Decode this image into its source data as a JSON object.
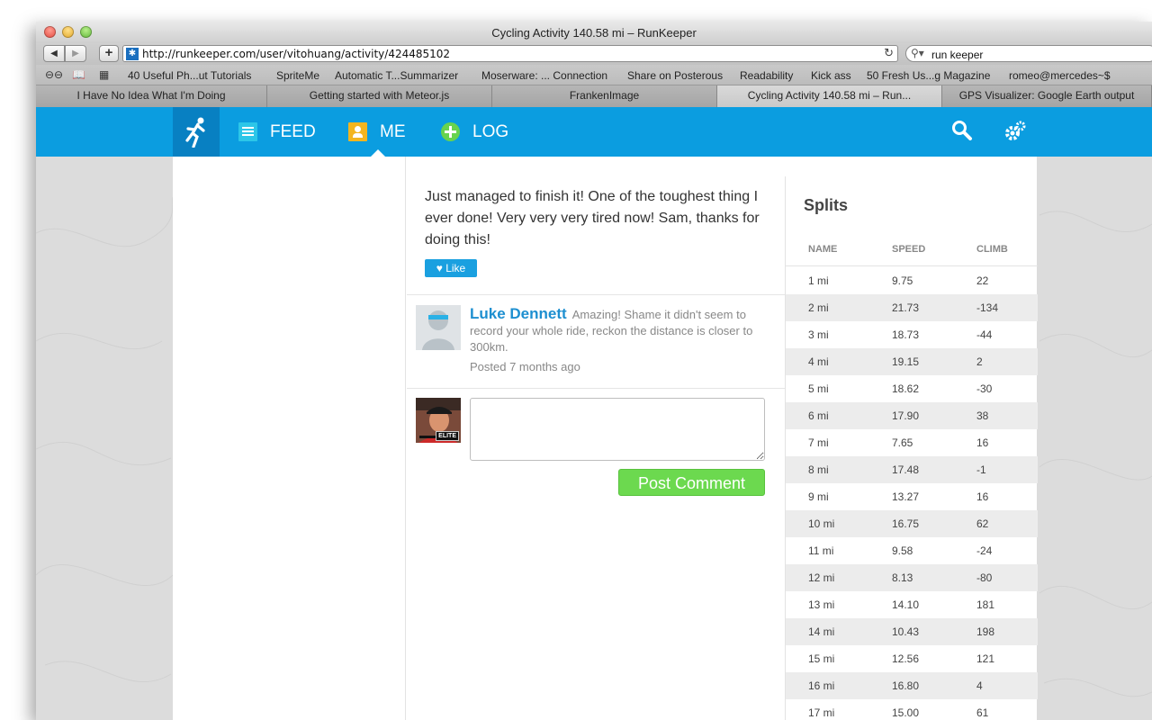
{
  "browser": {
    "window_title": "Cycling Activity 140.58 mi – RunKeeper",
    "url": "http://runkeeper.com/user/vitohuang/activity/424485102",
    "search_value": "run keeper",
    "bookmarks": [
      "40 Useful Ph...ut Tutorials",
      "SpriteMe",
      "Automatic T...Summarizer",
      "Moserware: ... Connection",
      "Share on Posterous",
      "Readability",
      "Kick ass",
      "50 Fresh Us...g Magazine",
      "romeo@mercedes~$"
    ],
    "tabs": [
      "I Have No Idea What I'm Doing",
      "Getting started with Meteor.js",
      "FrankenImage",
      "Cycling Activity 140.58 mi – Run...",
      "GPS Visualizer: Google Earth output"
    ]
  },
  "nav": {
    "feed": "FEED",
    "me": "ME",
    "log": "LOG"
  },
  "post": {
    "text": "Just managed to finish it! One of the toughest thing I ever done! Very very very tired now! Sam, thanks for doing this!",
    "like_label": "Like"
  },
  "comment": {
    "author": "Luke Dennett",
    "text": "Amazing! Shame it didn't seem to record your whole ride, reckon the distance is closer to 300km.",
    "meta": "Posted 7 months ago"
  },
  "composer": {
    "badge": "ELITE",
    "button": "Post Comment"
  },
  "splits": {
    "title": "Splits",
    "headers": {
      "name": "NAME",
      "speed": "SPEED",
      "climb": "CLIMB"
    },
    "rows": [
      {
        "name": "1 mi",
        "speed": "9.75",
        "climb": "22"
      },
      {
        "name": "2 mi",
        "speed": "21.73",
        "climb": "-134"
      },
      {
        "name": "3 mi",
        "speed": "18.73",
        "climb": "-44"
      },
      {
        "name": "4 mi",
        "speed": "19.15",
        "climb": "2"
      },
      {
        "name": "5 mi",
        "speed": "18.62",
        "climb": "-30"
      },
      {
        "name": "6 mi",
        "speed": "17.90",
        "climb": "38"
      },
      {
        "name": "7 mi",
        "speed": "7.65",
        "climb": "16"
      },
      {
        "name": "8 mi",
        "speed": "17.48",
        "climb": "-1"
      },
      {
        "name": "9 mi",
        "speed": "13.27",
        "climb": "16"
      },
      {
        "name": "10 mi",
        "speed": "16.75",
        "climb": "62"
      },
      {
        "name": "11 mi",
        "speed": "9.58",
        "climb": "-24"
      },
      {
        "name": "12 mi",
        "speed": "8.13",
        "climb": "-80"
      },
      {
        "name": "13 mi",
        "speed": "14.10",
        "climb": "181"
      },
      {
        "name": "14 mi",
        "speed": "10.43",
        "climb": "198"
      },
      {
        "name": "15 mi",
        "speed": "12.56",
        "climb": "121"
      },
      {
        "name": "16 mi",
        "speed": "16.80",
        "climb": "4"
      },
      {
        "name": "17 mi",
        "speed": "15.00",
        "climb": "61"
      }
    ]
  },
  "colors": {
    "nav_blue": "#0b9de0",
    "link_blue": "#1d8fd0",
    "post_green": "#6cd94f"
  }
}
